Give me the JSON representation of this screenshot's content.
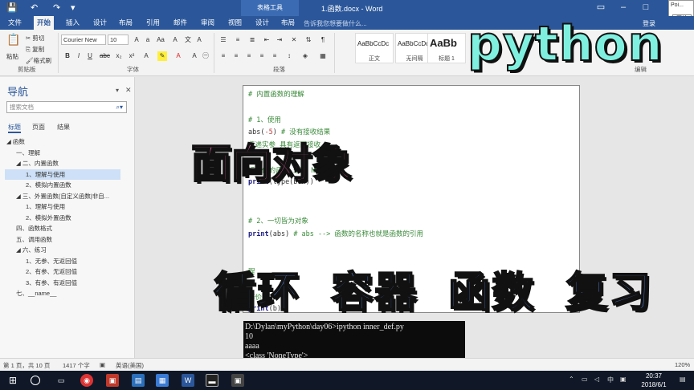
{
  "titlebar": {
    "context_tab": "表格工具",
    "document_title": "1.函数.docx - Word",
    "quick_access": [
      "💾",
      "↶",
      "↷",
      "▾"
    ]
  },
  "popup": {
    "title": "Poi...",
    "button": "开始"
  },
  "tabs": [
    {
      "label": "文件"
    },
    {
      "label": "开始"
    },
    {
      "label": "插入"
    },
    {
      "label": "设计"
    },
    {
      "label": "布局"
    },
    {
      "label": "引用"
    },
    {
      "label": "邮件"
    },
    {
      "label": "审阅"
    },
    {
      "label": "视图"
    },
    {
      "label": "设计"
    },
    {
      "label": "布局"
    }
  ],
  "tell_me": "告诉我您想要做什么...",
  "sign_in": "登录",
  "ribbon": {
    "clipboard": {
      "paste": "粘贴",
      "cut": "剪切",
      "copy": "复制",
      "format_painter": "格式刷",
      "label": "剪贴板"
    },
    "font": {
      "name": "Courier New",
      "size": "10",
      "label": "字体"
    },
    "paragraph": {
      "label": "段落"
    },
    "styles": [
      {
        "preview": "AaBbCcDc",
        "name": "正文"
      },
      {
        "preview": "AaBbCcDc",
        "name": "无间隔"
      },
      {
        "preview": "AaBb",
        "name": "标题 1"
      }
    ],
    "editing": {
      "label": "编辑"
    }
  },
  "nav": {
    "title": "导航",
    "search_placeholder": "搜索文档",
    "tabs": [
      "标题",
      "页面",
      "结果"
    ],
    "outline": [
      {
        "text": "◢ 函数",
        "level": 0
      },
      {
        "text": "一、理解",
        "level": 1
      },
      {
        "text": "◢ 二、内置函数",
        "level": 1
      },
      {
        "text": "1、理解与使用",
        "level": 2,
        "selected": true
      },
      {
        "text": "2、模拟内置函数",
        "level": 2
      },
      {
        "text": "◢ 三、外置函数(自定义函数|非自...",
        "level": 1
      },
      {
        "text": "1、理解与使用",
        "level": 2
      },
      {
        "text": "2、模拟外置函数",
        "level": 2
      },
      {
        "text": "四、函数格式",
        "level": 1
      },
      {
        "text": "五、调用函数",
        "level": 1
      },
      {
        "text": "◢ 六、练习",
        "level": 1
      },
      {
        "text": "1、无参、无返回值",
        "level": 2
      },
      {
        "text": "2、有参、无返回值",
        "level": 2
      },
      {
        "text": "3、有参、有返回值",
        "level": 2
      },
      {
        "text": "七、__name__",
        "level": 1
      }
    ]
  },
  "document": {
    "lines": [
      {
        "parts": [
          {
            "t": "# 内置函数的理解",
            "c": "c-com"
          }
        ]
      },
      {
        "parts": []
      },
      {
        "parts": [
          {
            "t": "# 1、使用",
            "c": "c-com"
          }
        ]
      },
      {
        "parts": [
          {
            "t": "abs(",
            "c": "c-plain"
          },
          {
            "t": "-5",
            "c": "c-num"
          },
          {
            "t": ")  ",
            "c": "c-plain"
          },
          {
            "t": "# 没有接收结果",
            "c": "c-com"
          }
        ]
      },
      {
        "parts": [
          {
            "t": "                               传递实参 具有返回接收",
            "c": "c-com"
          }
        ]
      },
      {
        "parts": []
      },
      {
        "parts": [
          {
            "t": "                               返回值的函数 返回 None",
            "c": "c-com"
          }
        ]
      },
      {
        "parts": [
          {
            "t": "print",
            "c": "c-kw"
          },
          {
            "t": "(type(box))",
            "c": "c-plain"
          }
        ]
      },
      {
        "parts": []
      },
      {
        "parts": []
      },
      {
        "parts": [
          {
            "t": "# 2、一切皆为对象",
            "c": "c-com"
          }
        ]
      },
      {
        "parts": [
          {
            "t": "print",
            "c": "c-kw"
          },
          {
            "t": "(abs)  ",
            "c": "c-plain"
          },
          {
            "t": "# abs --> 函数的名称也就是函数的引用",
            "c": "c-com"
          }
        ]
      },
      {
        "parts": []
      },
      {
        "parts": []
      },
      {
        "parts": [
          {
            "t": "           程",
            "c": "c-com"
          }
        ]
      },
      {
        "parts": []
      },
      {
        "parts": [
          {
            "t": "           等价于",
            "c": "c-com"
          }
        ]
      },
      {
        "parts": [
          {
            "t": "print",
            "c": "c-kw"
          },
          {
            "t": "(b)",
            "c": "c-plain"
          }
        ]
      }
    ]
  },
  "console": [
    "D:\\Dylan\\myPython\\day06>ipython inner_def.py",
    "10",
    "aaaa",
    "<class 'NoneType'>"
  ],
  "overlay": {
    "python": "python",
    "oop": "面向对象",
    "review": "循环 容器 函数 复习"
  },
  "status": {
    "page": "第 1 页，共 10 页",
    "words": "1417 个字",
    "lang": "英语(美国)",
    "zoom": "120%"
  },
  "taskbar": {
    "time": "20:37",
    "date": "2018/6/1",
    "ime": "中"
  }
}
